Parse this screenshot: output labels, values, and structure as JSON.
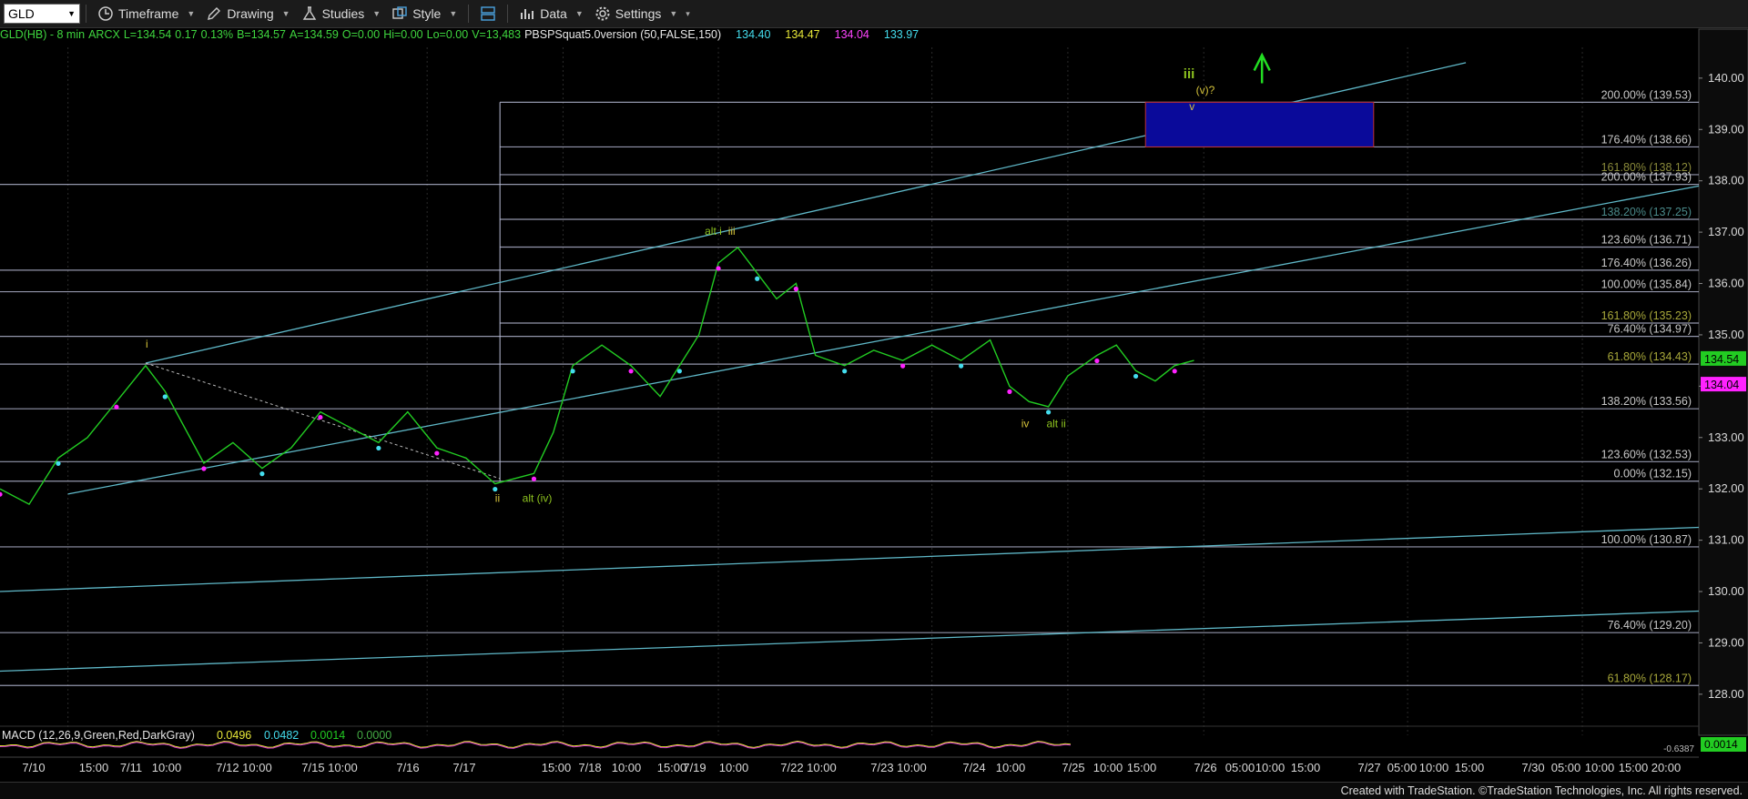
{
  "toolbar": {
    "symbol": "GLD",
    "timeframe_label": "Timeframe",
    "drawing_label": "Drawing",
    "studies_label": "Studies",
    "style_label": "Style",
    "data_label": "Data",
    "settings_label": "Settings"
  },
  "infobar": {
    "symbol_desc": "GLD(HB) - 8 min",
    "exchange": "ARCX",
    "last": "L=134.54",
    "change": "0.17",
    "pct": "0.13%",
    "bid": "B=134.57",
    "ask": "A=134.59",
    "open": "O=0.00",
    "hi": "Hi=0.00",
    "lo": "Lo=0.00",
    "vol": "V=13,483",
    "study": "PBSPSquat5.0version (50,FALSE,150)",
    "s1": "134.40",
    "s2": "134.47",
    "s3": "134.04",
    "s4": "133.97"
  },
  "colors": {
    "price": "#22cc22",
    "fib_line": "#b8bcd6",
    "channel": "#5fb8c8",
    "target_box": "#0a0a9a",
    "wave_green": "#8dc21f",
    "wave_yellow": "#d4c23a",
    "magenta": "#ff22ff",
    "cyan_dot": "#44ddee"
  },
  "chart_data": {
    "type": "line",
    "title": "GLD(HB) - 8 min",
    "ylim": [
      127.2,
      140.6
    ],
    "y_ticks": [
      128.0,
      129.0,
      130.0,
      131.0,
      132.0,
      133.0,
      134.0,
      135.0,
      136.0,
      137.0,
      138.0,
      139.0,
      140.0
    ],
    "y_tick_labels": [
      "128.00",
      "129.00",
      "130.00",
      "131.00",
      "132.00",
      "133.00",
      "134.00",
      "135.00",
      "136.00",
      "137.00",
      "138.00",
      "139.00",
      "140.00"
    ],
    "x_labels": [
      "7/10",
      "15:00",
      "7/11",
      "10:00",
      "7/12 10:00",
      "7/15 10:00",
      "7/16",
      "7/17",
      "15:00",
      "7/18",
      "10:00",
      "15:00",
      "7/19",
      "10:00",
      "7/22 10:00",
      "7/23 10:00",
      "7/24",
      "10:00",
      "7/25",
      "10:00",
      "15:00",
      "7/26",
      "05:00",
      "10:00",
      "15:00",
      "7/27",
      "05:00",
      "10:00",
      "15:00",
      "7/30",
      "05:00",
      "10:00",
      "15:00",
      "20:00"
    ],
    "fib_levels": [
      {
        "label": "200.00% (139.53)",
        "value": 139.53,
        "color": "#c8c8c8"
      },
      {
        "label": "176.40% (138.66)",
        "value": 138.66,
        "color": "#c8c8c8"
      },
      {
        "label": "161.80% (138.12)",
        "value": 138.12,
        "color": "#8a8a3a"
      },
      {
        "label": "200.00% (137.93)",
        "value": 137.93,
        "color": "#c8c8c8"
      },
      {
        "label": "138.20% (137.25)",
        "value": 137.25,
        "color": "#4a8a8a"
      },
      {
        "label": "123.60% (136.71)",
        "value": 136.71,
        "color": "#c8c8c8"
      },
      {
        "label": "176.40% (136.26)",
        "value": 136.26,
        "color": "#c8c8c8"
      },
      {
        "label": "100.00% (135.84)",
        "value": 135.84,
        "color": "#c8c8c8"
      },
      {
        "label": "161.80% (135.23)",
        "value": 135.23,
        "color": "#a8a83a"
      },
      {
        "label": "76.40% (134.97)",
        "value": 134.97,
        "color": "#c8c8c8"
      },
      {
        "label": "61.80% (134.43)",
        "value": 134.43,
        "color": "#a8a83a"
      },
      {
        "label": "138.20% (133.56)",
        "value": 133.56,
        "color": "#c8c8c8"
      },
      {
        "label": "123.60% (132.53)",
        "value": 132.53,
        "color": "#c8c8c8"
      },
      {
        "label": "0.00% (132.15)",
        "value": 132.15,
        "color": "#c8c8c8"
      },
      {
        "label": "100.00% (130.87)",
        "value": 130.87,
        "color": "#c8c8c8"
      },
      {
        "label": "76.40% (129.20)",
        "value": 129.2,
        "color": "#c8c8c8"
      },
      {
        "label": "61.80% (128.17)",
        "value": 128.17,
        "color": "#a8a83a"
      }
    ],
    "target_box": {
      "low": 138.66,
      "high": 139.53
    },
    "price_tags": [
      {
        "label": "134.54",
        "value": 134.54,
        "color": "#22cc22"
      },
      {
        "label": "134.04",
        "value": 134.04,
        "color": "#ff22ff"
      }
    ],
    "wave_labels": [
      "i",
      "ii",
      "alt (iv)",
      "alt i",
      "iii",
      "iv",
      "alt ii",
      "iii",
      "(v)?",
      "v"
    ],
    "price_series": [
      {
        "x": 0,
        "y": 132.0
      },
      {
        "x": 3,
        "y": 131.7
      },
      {
        "x": 6,
        "y": 132.6
      },
      {
        "x": 9,
        "y": 133.0
      },
      {
        "x": 12,
        "y": 133.7
      },
      {
        "x": 15,
        "y": 134.4
      },
      {
        "x": 17,
        "y": 133.9
      },
      {
        "x": 19,
        "y": 133.2
      },
      {
        "x": 21,
        "y": 132.5
      },
      {
        "x": 24,
        "y": 132.9
      },
      {
        "x": 27,
        "y": 132.4
      },
      {
        "x": 30,
        "y": 132.8
      },
      {
        "x": 33,
        "y": 133.5
      },
      {
        "x": 36,
        "y": 133.2
      },
      {
        "x": 39,
        "y": 132.9
      },
      {
        "x": 42,
        "y": 133.5
      },
      {
        "x": 45,
        "y": 132.8
      },
      {
        "x": 48,
        "y": 132.6
      },
      {
        "x": 51,
        "y": 132.1
      },
      {
        "x": 53,
        "y": 132.2
      },
      {
        "x": 55,
        "y": 132.3
      },
      {
        "x": 57,
        "y": 133.1
      },
      {
        "x": 59,
        "y": 134.4
      },
      {
        "x": 62,
        "y": 134.8
      },
      {
        "x": 65,
        "y": 134.4
      },
      {
        "x": 68,
        "y": 133.8
      },
      {
        "x": 70,
        "y": 134.4
      },
      {
        "x": 72,
        "y": 135.0
      },
      {
        "x": 74,
        "y": 136.4
      },
      {
        "x": 76,
        "y": 136.7
      },
      {
        "x": 78,
        "y": 136.2
      },
      {
        "x": 80,
        "y": 135.7
      },
      {
        "x": 82,
        "y": 136.0
      },
      {
        "x": 84,
        "y": 134.6
      },
      {
        "x": 87,
        "y": 134.4
      },
      {
        "x": 90,
        "y": 134.7
      },
      {
        "x": 93,
        "y": 134.5
      },
      {
        "x": 96,
        "y": 134.8
      },
      {
        "x": 99,
        "y": 134.5
      },
      {
        "x": 102,
        "y": 134.9
      },
      {
        "x": 104,
        "y": 134.0
      },
      {
        "x": 106,
        "y": 133.7
      },
      {
        "x": 108,
        "y": 133.6
      },
      {
        "x": 110,
        "y": 134.2
      },
      {
        "x": 113,
        "y": 134.6
      },
      {
        "x": 115,
        "y": 134.8
      },
      {
        "x": 117,
        "y": 134.3
      },
      {
        "x": 119,
        "y": 134.1
      },
      {
        "x": 121,
        "y": 134.4
      },
      {
        "x": 123,
        "y": 134.5
      }
    ],
    "macd": {
      "label": "MACD (12,26,9,Green,Red,DarkGray)",
      "values": [
        "0.0496",
        "0.0482",
        "0.0014",
        "0.0000"
      ],
      "right_tags": [
        "0.0014",
        "-0.6387"
      ]
    }
  },
  "footer": "Created with TradeStation. ©TradeStation Technologies, Inc. All rights reserved."
}
